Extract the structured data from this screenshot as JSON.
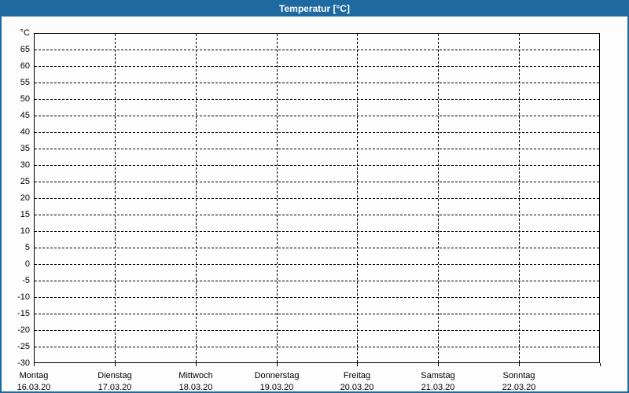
{
  "window": {
    "title": "Temperatur [°C]"
  },
  "colors": {
    "frame_blue": "#1e69a0",
    "title_text": "#ffffff",
    "grid_line": "#000000",
    "label_text": "#000000",
    "background": "#fdfdfd"
  },
  "chart_data": {
    "type": "line",
    "title": "Temperatur [°C]",
    "ylabel": "°C",
    "ylim": [
      -30,
      70
    ],
    "ytick_step": 5,
    "ytick_labels": [
      65,
      60,
      55,
      50,
      45,
      40,
      35,
      30,
      25,
      20,
      15,
      10,
      5,
      0,
      -5,
      -10,
      -15,
      -20,
      -25,
      -30
    ],
    "grid": "dashed",
    "legend": "none",
    "categories": [
      {
        "name": "Montag",
        "date": "16.03.20"
      },
      {
        "name": "Dienstag",
        "date": "17.03.20"
      },
      {
        "name": "Mittwoch",
        "date": "18.03.20"
      },
      {
        "name": "Donnerstag",
        "date": "19.03.20"
      },
      {
        "name": "Freitag",
        "date": "20.03.20"
      },
      {
        "name": "Samstag",
        "date": "21.03.20"
      },
      {
        "name": "Sonntag",
        "date": "22.03.20"
      }
    ],
    "series": []
  },
  "layout_note": "empty plot area, no data series plotted"
}
